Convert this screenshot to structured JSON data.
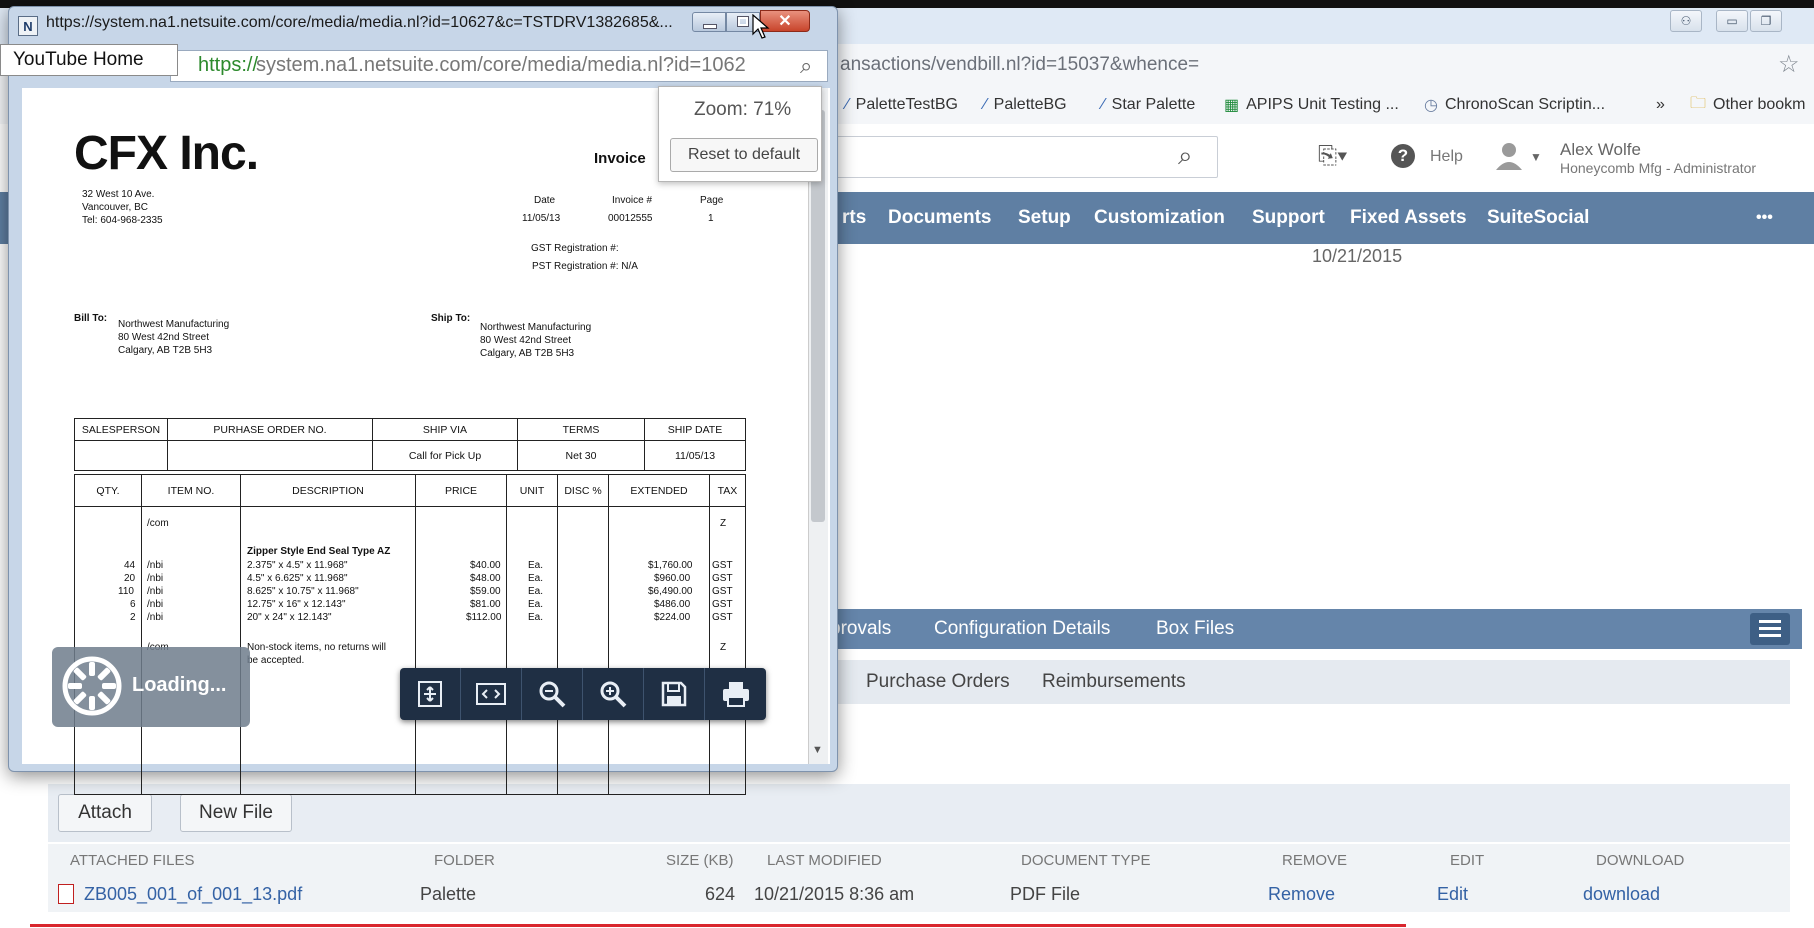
{
  "colors": {
    "nav_bg": "#5f7fa3",
    "subtab_bg": "#6585aa",
    "link": "#3462a5",
    "https_green": "#2d8a2d",
    "close_red": "#c8442b"
  },
  "popup": {
    "title": "https://system.na1.netsuite.com/core/media/media.nl?id=10627&c=TSTDRV1382685&...",
    "url_https": "https://",
    "url_rest": "system.na1.netsuite.com/core/media/media.nl?id=1062",
    "zoom_icon": "zoom-icon",
    "zoom": {
      "label": "Zoom: 71%",
      "reset_label": "Reset to default"
    },
    "loading_label": "Loading...",
    "toolbar": [
      "fit-page-icon",
      "fit-width-icon",
      "zoom-out-icon",
      "zoom-in-icon",
      "save-icon",
      "print-icon"
    ]
  },
  "tooltip": "YouTube Home",
  "invoice": {
    "company": "CFX Inc.",
    "doc_title": "Invoice",
    "address": [
      "32 West 10 Ave.",
      "Vancouver, BC",
      "Tel: 604-968-2335"
    ],
    "meta_headers": [
      "Date",
      "Invoice #",
      "Page"
    ],
    "meta_values": [
      "11/05/13",
      "00012555",
      "1"
    ],
    "gst": "GST Registration #:",
    "pst": "PST Registration #: N/A",
    "bill_to_label": "Bill To:",
    "bill_to": [
      "Northwest Manufacturing",
      "80 West 42nd Street",
      "Calgary, AB T2B 5H3"
    ],
    "ship_to_label": "Ship To:",
    "ship_to": [
      "Northwest Manufacturing",
      "80 West 42nd Street",
      "Calgary, AB T2B 5H3"
    ],
    "header_cols": [
      "SALESPERSON",
      "PURHASE ORDER NO.",
      "SHIP VIA",
      "TERMS",
      "SHIP DATE"
    ],
    "header_vals": [
      "",
      "",
      "Call for Pick Up",
      "Net 30",
      "11/05/13"
    ],
    "line_cols": [
      "QTY.",
      "ITEM NO.",
      "DESCRIPTION",
      "PRICE",
      "UNIT",
      "DISC %",
      "EXTENDED",
      "TAX"
    ],
    "lines": [
      {
        "qty": "",
        "item": "/com",
        "desc": "",
        "price": "",
        "unit": "",
        "ext": "",
        "tax": "Z"
      },
      {
        "qty": "",
        "item": "",
        "desc": "Zipper Style End Seal Type AZ",
        "price": "",
        "unit": "",
        "ext": "",
        "tax": ""
      },
      {
        "qty": "44",
        "item": "/nbi",
        "desc": "2.375\" x 4.5\" x 11.968\"",
        "price": "$40.00",
        "unit": "Ea.",
        "ext": "$1,760.00",
        "tax": "GST"
      },
      {
        "qty": "20",
        "item": "/nbi",
        "desc": "4.5\" x 6.625\" x 11.968\"",
        "price": "$48.00",
        "unit": "Ea.",
        "ext": "$960.00",
        "tax": "GST"
      },
      {
        "qty": "110",
        "item": "/nbi",
        "desc": "8.625\" x 10.75\" x 11.968\"",
        "price": "$59.00",
        "unit": "Ea.",
        "ext": "$6,490.00",
        "tax": "GST"
      },
      {
        "qty": "6",
        "item": "/nbi",
        "desc": "12.75\" x 16\" x 12.143\"",
        "price": "$81.00",
        "unit": "Ea.",
        "ext": "$486.00",
        "tax": "GST"
      },
      {
        "qty": "2",
        "item": "/nbi",
        "desc": "20\" x 24\" x 12.143\"",
        "price": "$112.00",
        "unit": "Ea.",
        "ext": "$224.00",
        "tax": "GST"
      }
    ],
    "note_item": "/com",
    "note_tax": "Z",
    "note": [
      "Non-stock items, no returns will",
      "be accepted."
    ]
  },
  "browser": {
    "url": "ansactions/vendbill.nl?id=15037&whence=",
    "bookmarks": [
      "PaletteTestBG",
      "PaletteBG",
      "Star Palette",
      "APIPS Unit Testing ...",
      "ChronoScan Scriptin...",
      "»",
      "Other bookm"
    ],
    "help": "Help",
    "user_name": "Alex Wolfe",
    "user_role": "Honeycomb Mfg - Administrator",
    "nav": [
      "rts",
      "Documents",
      "Setup",
      "Customization",
      "Support",
      "Fixed Assets",
      "SuiteSocial",
      "•••"
    ],
    "date": "10/21/2015",
    "subtabs": [
      "provals",
      "Configuration Details",
      "Box Files"
    ],
    "subsubtabs": [
      "Purchase Orders",
      "Reimbursements"
    ],
    "buttons": {
      "attach": "Attach",
      "new_file": "New File"
    },
    "table_headers": [
      "ATTACHED FILES",
      "FOLDER",
      "SIZE (KB)",
      "LAST MODIFIED",
      "DOCUMENT TYPE",
      "REMOVE",
      "EDIT",
      "DOWNLOAD"
    ],
    "file_row": {
      "name": "ZB005_001_of_001_13.pdf",
      "folder": "Palette",
      "size": "624",
      "modified": "10/21/2015 8:36 am",
      "type": "PDF File",
      "remove": "Remove",
      "edit": "Edit",
      "download": "download"
    }
  }
}
